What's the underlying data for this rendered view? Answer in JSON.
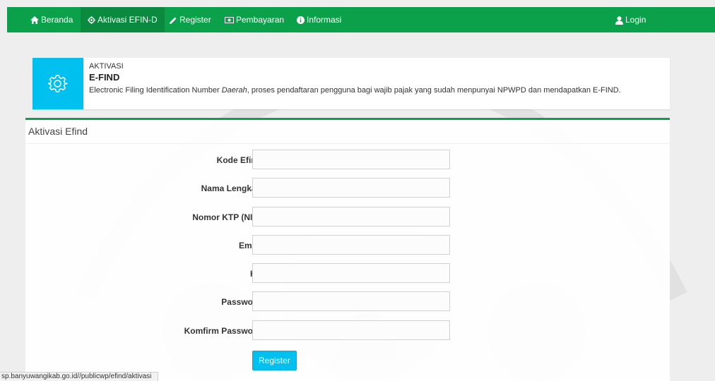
{
  "nav": {
    "items": [
      {
        "label": "Beranda",
        "icon": "home-icon"
      },
      {
        "label": "Aktivasi EFIN-D",
        "icon": "gear-icon"
      },
      {
        "label": "Register",
        "icon": "pencil-icon"
      },
      {
        "label": "Pembayaran",
        "icon": "money-icon"
      },
      {
        "label": "Informasi",
        "icon": "info-icon"
      }
    ],
    "login": {
      "label": "Login",
      "icon": "user-icon"
    }
  },
  "info": {
    "small_label": "AKTIVASI",
    "title": "E-FIND",
    "desc_before": "Electronic Filing Identification Number ",
    "desc_italic": "Daerah",
    "desc_after": ", proses pendaftaran pengguna bagi wajib pajak yang sudah menpunyai NPWPD dan mendapatkan E-FIND."
  },
  "form": {
    "title": "Aktivasi Efind",
    "fields": [
      {
        "label": "Kode Efind",
        "value": ""
      },
      {
        "label": "Nama Lengkap",
        "value": ""
      },
      {
        "label": "Nomor KTP (NIK)",
        "value": ""
      },
      {
        "label": "Email",
        "value": ""
      },
      {
        "label": "Hp",
        "value": ""
      },
      {
        "label": "Password",
        "value": ""
      },
      {
        "label": "Komfirm Password",
        "value": ""
      }
    ],
    "submit_label": "Register"
  },
  "status_url": "sp.banyuwangikab.go.id//publicwp/efind/aktivasi",
  "colors": {
    "nav_bg": "#0ba14a",
    "accent": "#00c0ef"
  }
}
